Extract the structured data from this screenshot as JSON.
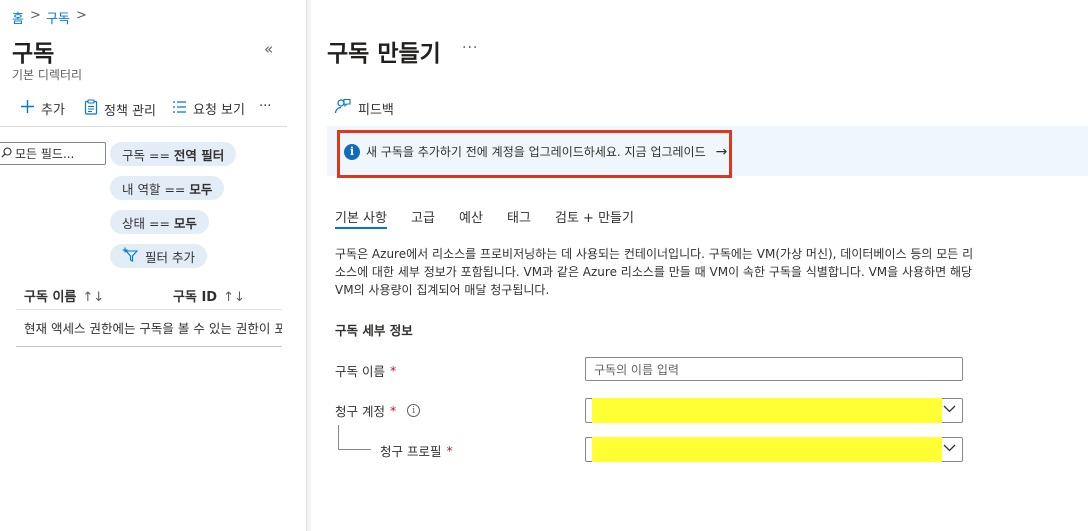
{
  "breadcrumb": {
    "home": "홈",
    "subscriptions": "구독",
    "sep": ">"
  },
  "left_panel": {
    "title": "구독",
    "subtitle": "기본 디렉터리",
    "collapse": "«",
    "toolbar": {
      "add": "추가",
      "policy": "정책 관리",
      "requests": "요청 보기",
      "more": "···"
    },
    "filter_placeholder": "모든 필드...",
    "filters": [
      {
        "prefix": "구독 ==",
        "value": "전역 필터"
      },
      {
        "prefix": "내 역할 ==",
        "value": "모두"
      },
      {
        "prefix": "상태 ==",
        "value": "모두"
      }
    ],
    "add_filter": "필터 추가",
    "columns": {
      "name": "구독 이름",
      "id": "구독 ID",
      "sort": "↑↓"
    },
    "empty_message": "현재 액세스 권한에는 구독을 볼 수 있는 권한이 포함되어 있지 않습니다."
  },
  "main": {
    "title": "구독 만들기",
    "more": "···",
    "feedback": "피드백",
    "banner": {
      "text": "새 구독을 추가하기 전에 계정을 업그레이드하세요. 지금 업그레이드",
      "arrow": "→"
    },
    "tabs": [
      "기본 사항",
      "고급",
      "예산",
      "태그",
      "검토 + 만들기"
    ],
    "description": "구독은 Azure에서 리소스를 프로비저닝하는 데 사용되는 컨테이너입니다. 구독에는 VM(가상 머신), 데이터베이스 등의 모든 리소스에 대한 세부 정보가 포함됩니다. VM과 같은 Azure 리소스를 만들 때 VM이 속한 구독을 식별합니다. VM을 사용하면 해당 VM의 사용량이 집계되어 매달 청구됩니다.",
    "section_title": "구독 세부 정보",
    "fields": {
      "name_label": "구독 이름",
      "name_placeholder": "구독의 이름 입력",
      "billing_account_label": "청구 계정",
      "billing_profile_label": "청구 프로필",
      "required": "*"
    }
  },
  "colors": {
    "accent": "#0078d4",
    "highlight_border": "#e0361e",
    "redaction": "#ffff33",
    "banner_bg": "#eff6fc"
  }
}
